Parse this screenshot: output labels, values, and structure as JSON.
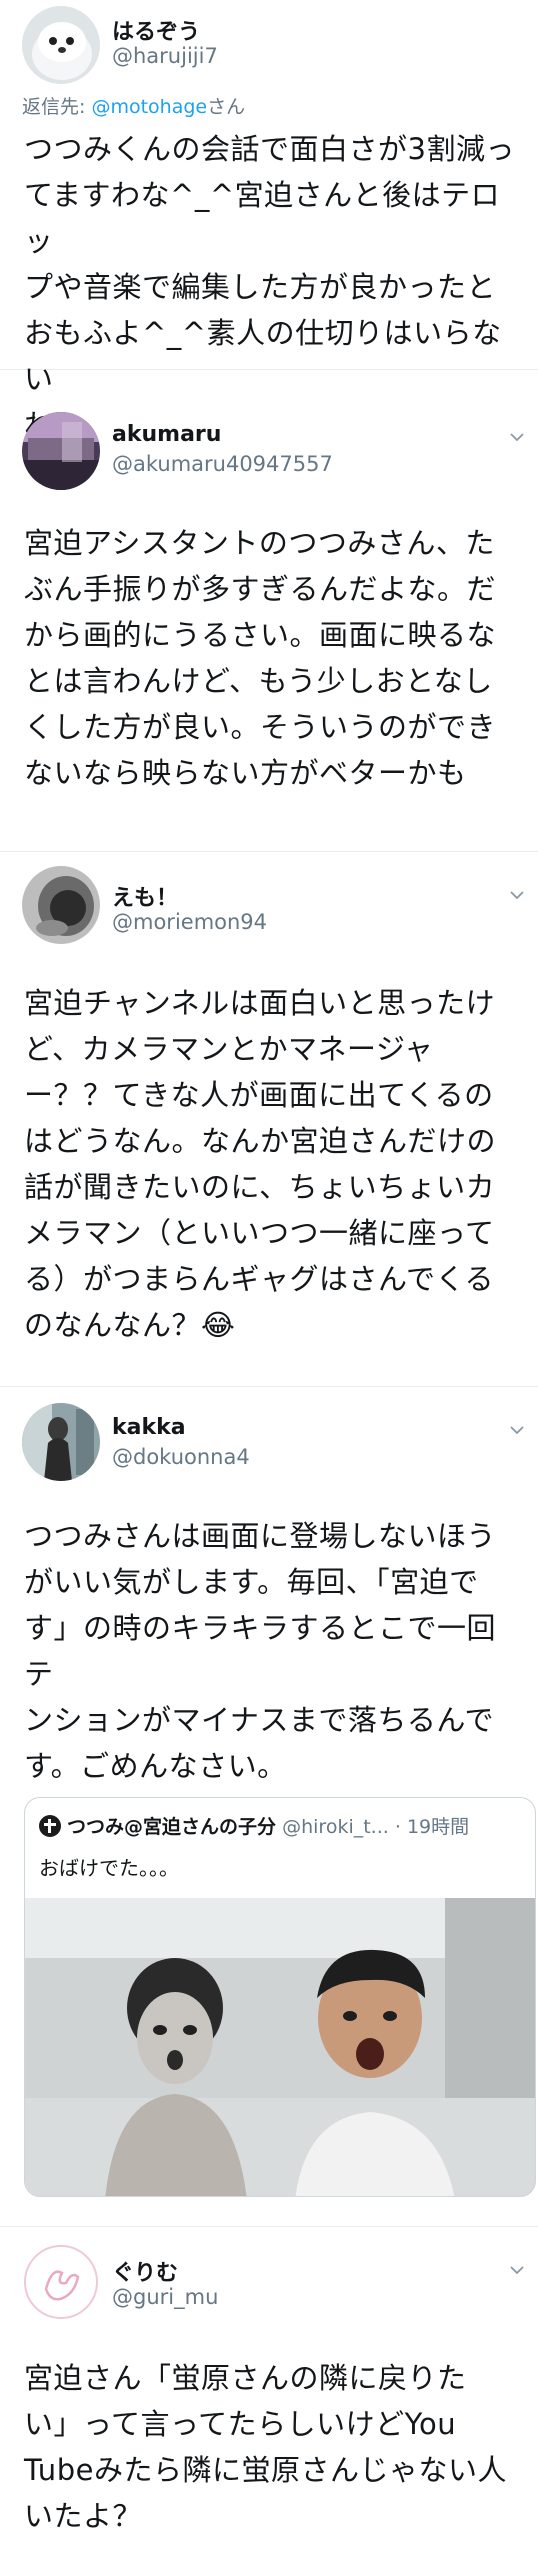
{
  "tweets": [
    {
      "name": "はるぞう",
      "handle": "@harujiji7",
      "reply_prefix": "返信先: ",
      "reply_to": "@motohage",
      "reply_suffix": "さん",
      "lines": [
        "つつみくんの会話で面白さが3割減っ",
        "てますわな^_^宮迫さんと後はテロッ",
        "プや音楽で編集した方が良かったと",
        "おもふよ^_^素人の仕切りはいらない",
        "ね"
      ]
    },
    {
      "name": "akumaru",
      "handle": "@akumaru40947557",
      "lines": [
        "宮迫アシスタントのつつみさん、た",
        "ぶん手振りが多すぎるんだよな。だ",
        "から画的にうるさい。画面に映るな",
        "とは言わんけど、もう少しおとなし",
        "くした方が良い。そういうのができ",
        "ないなら映らない方がベターかも"
      ]
    },
    {
      "name": "えも！",
      "handle": "@moriemon94",
      "lines": [
        "宮迫チャンネルは面白いと思ったけ",
        "ど、カメラマンとかマネージャ",
        "ー？？てきな人が画面に出てくるの",
        "はどうなん。なんか宮迫さんだけの",
        "話が聞きたいのに、ちょいちょいカ",
        "メラマン（といいつつ一緒に座って",
        "る）がつまらんギャグはさんでくる",
        "のなんなん？😂"
      ]
    },
    {
      "name": "kakka",
      "handle": "@dokuonna4",
      "lines": [
        "つつみさんは画面に登場しないほう",
        "がいい気がします。毎回、「宮迫で",
        "す」の時のキラキラするとこで一回テ",
        "ンションがマイナスまで落ちるんで",
        "す。ごめんなさい。"
      ],
      "quote": {
        "name": "つつみ@宮迫さんの子分",
        "handle": "@hiroki_t...",
        "time": "· 19時間",
        "text": "おばけでた。。。"
      }
    },
    {
      "name": "ぐりむ",
      "handle": "@guri_mu",
      "lines": [
        "宮迫さん「蛍原さんの隣に戻りた",
        "い」って言ってたらしいけどYou",
        "Tubeみたら隣に蛍原さんじゃない人",
        "いたよ？"
      ]
    }
  ],
  "colors": {
    "text": "#14171a",
    "secondary": "#657786",
    "link": "#1da1f2",
    "divider": "#e6ecf0"
  },
  "icons": [
    "chevron-down-icon",
    "avatar-image",
    "photo-image"
  ]
}
